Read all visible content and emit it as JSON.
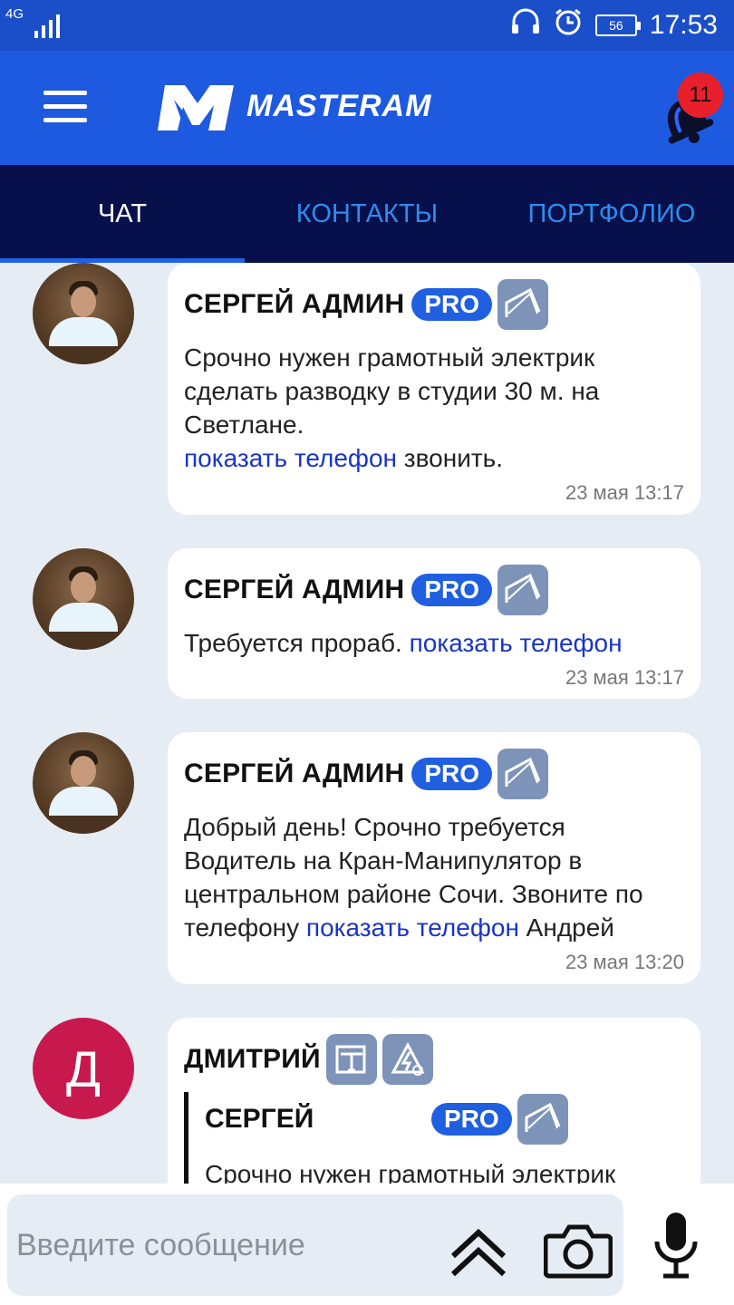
{
  "status_bar": {
    "network": "4G",
    "battery": "56",
    "time": "17:53"
  },
  "header": {
    "brand": "MASTERAM",
    "notifications_count": "11"
  },
  "tabs": [
    {
      "label": "ЧАТ",
      "active": true
    },
    {
      "label": "КОНТАКТЫ",
      "active": false
    },
    {
      "label": "ПОРТФОЛИО",
      "active": false
    }
  ],
  "messages": [
    {
      "author": "СЕРГЕЙ АДМИН",
      "pro": "PRO",
      "text_before": "Срочно нужен грамотный электрик сделать разводку в студии 30 м. на Светлане.",
      "link": "показать телефон",
      "text_after": " звонить.",
      "time": "23 мая 13:17"
    },
    {
      "author": "СЕРГЕЙ АДМИН",
      "pro": "PRO",
      "text_before": "Требуется прораб. ",
      "link": "показать телефон",
      "text_after": "",
      "time": "23 мая 13:17"
    },
    {
      "author": "СЕРГЕЙ АДМИН",
      "pro": "PRO",
      "text_before": "Добрый день! Срочно требуется Водитель на Кран-Манипулятор в центральном районе Сочи. Звоните по телефону ",
      "link": "показать телефон",
      "text_after": " Андрей",
      "time": "23 мая 13:20"
    },
    {
      "author": "ДМИТРИЙ",
      "avatar_letter": "Д",
      "quote": {
        "author": "СЕРГЕЙ",
        "pro": "PRO",
        "text": "Срочно нужен грамотный электрик"
      }
    }
  ],
  "input": {
    "placeholder": "Введите сообщение"
  },
  "colors": {
    "status_bar": "#1a4fc9",
    "app_bar": "#1e5ae0",
    "tabs_bg": "#07104a",
    "tab_inactive": "#2d8cf0",
    "pro_badge": "#1f5fe0",
    "badge_icon": "#7d93b8",
    "link": "#1a35c4",
    "notification": "#e8202b",
    "letter_avatar": "#c8194f"
  },
  "icons": {
    "menu": "hamburger-icon",
    "notifications": "bell-icon",
    "scroll_up": "double-chevron-up-icon",
    "camera": "camera-icon",
    "microphone": "microphone-icon",
    "badges": [
      "roof-icon",
      "paint-roller-icon",
      "electric-icon"
    ]
  }
}
